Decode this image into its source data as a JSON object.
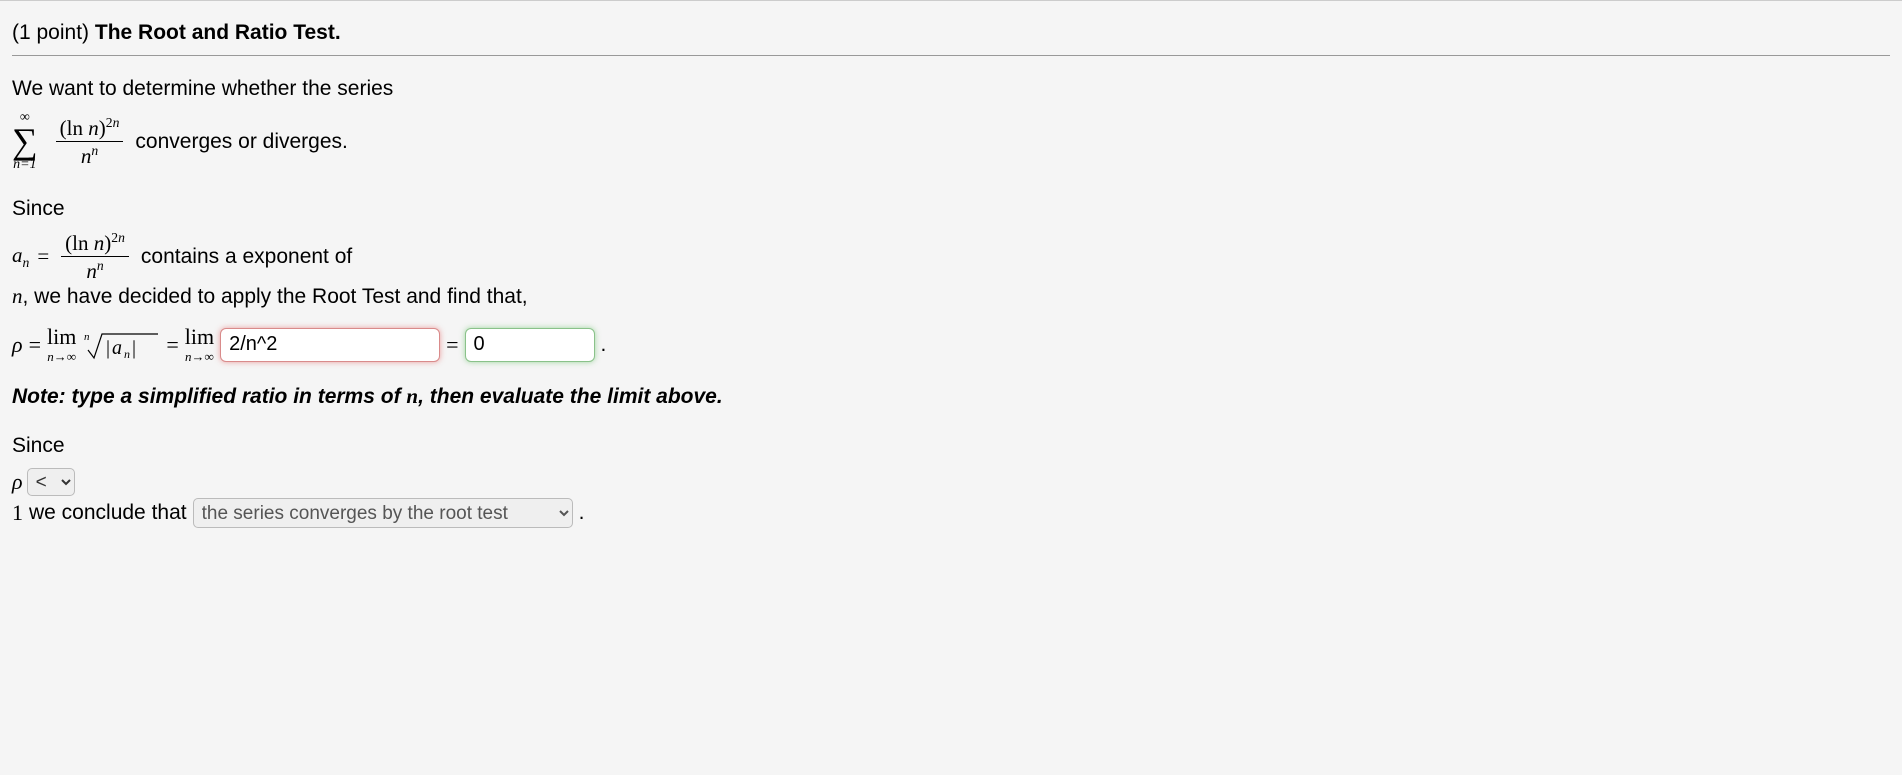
{
  "header": {
    "points": "(1 point)",
    "title": "The Root and Ratio Test."
  },
  "intro": "We want to determine whether the series",
  "series_tail": "converges or diverges.",
  "since1": "Since",
  "contains_text": "contains a exponent of",
  "line_n_text": ", we have decided to apply the Root Test and find that,",
  "rho_sym": "ρ",
  "equals": "=",
  "dot": ".",
  "input1_value": "2/n^2",
  "input2_value": "0",
  "note_prefix": "Note: type a simplified ratio in terms of ",
  "note_suffix": ", then evaluate the limit above.",
  "since2": "Since",
  "rho_select_value": "<",
  "one_text": "1",
  "conclude_text": "we conclude that",
  "conclusion_select_value": "the series converges by the root test",
  "math": {
    "sum_top": "∞",
    "sum_bottom": "n=1",
    "frac_num": "(ln n)",
    "frac_num_exp": "2n",
    "frac_den_base": "n",
    "frac_den_exp": "n",
    "a_n": "a",
    "a_n_sub": "n",
    "n_var": "n",
    "lim_word": "lim",
    "lim_sub": "n→∞",
    "root_index": "n",
    "root_body_a": "a",
    "root_body_sub": "n",
    "abs_bar": "|"
  }
}
